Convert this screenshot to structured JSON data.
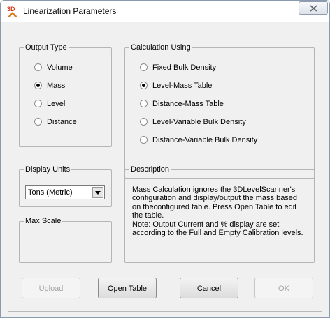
{
  "window": {
    "title": "Linearization Parameters",
    "app_icon": "3d-level-icon"
  },
  "output_type": {
    "legend": "Output Type",
    "options": [
      {
        "label": "Volume",
        "checked": false
      },
      {
        "label": "Mass",
        "checked": true
      },
      {
        "label": "Level",
        "checked": false
      },
      {
        "label": "Distance",
        "checked": false
      }
    ]
  },
  "calculation": {
    "legend": "Calculation Using",
    "options": [
      {
        "label": "Fixed Bulk Density",
        "checked": false
      },
      {
        "label": "Level-Mass Table",
        "checked": true
      },
      {
        "label": "Distance-Mass Table",
        "checked": false
      },
      {
        "label": "Level-Variable Bulk Density",
        "checked": false
      },
      {
        "label": "Distance-Variable Bulk Density",
        "checked": false
      }
    ]
  },
  "display_units": {
    "legend": "Display Units",
    "selected": "Tons (Metric)"
  },
  "max_scale": {
    "legend": "Max Scale"
  },
  "description": {
    "legend": "Description",
    "lines": [
      "Mass Calculation ignores the 3DLevelScanner's",
      "configuration and display/output the mass based",
      "on theconfigured table. Press Open Table to edit",
      "the table.",
      "Note: Output Current and % display are set",
      "according to the Full and Empty Calibration levels."
    ]
  },
  "buttons": {
    "upload": "Upload",
    "open_table": "Open Table",
    "cancel": "Cancel",
    "ok": "OK"
  }
}
